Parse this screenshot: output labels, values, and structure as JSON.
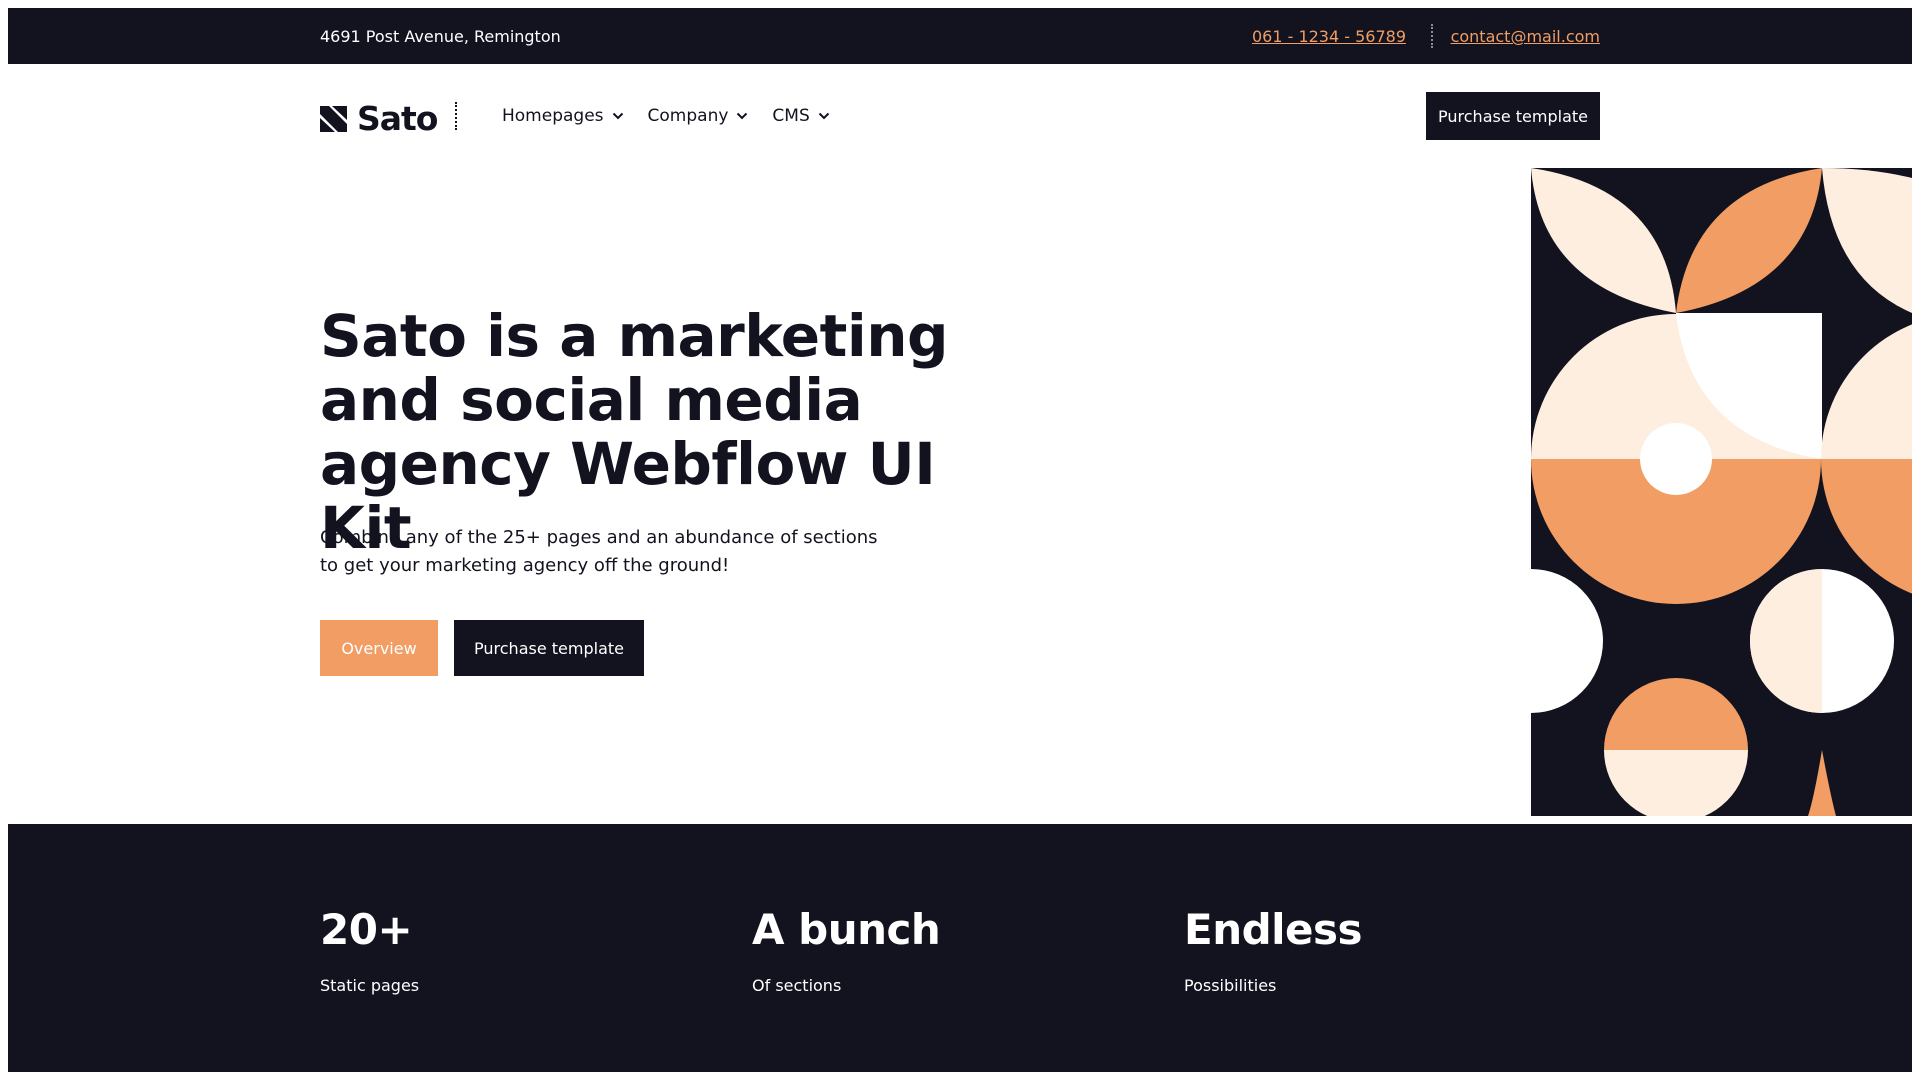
{
  "colors": {
    "dark": "#12131f",
    "accent": "#f19d64",
    "cream": "#fdeee0",
    "white": "#ffffff"
  },
  "topbar": {
    "address": "4691  Post Avenue, Remington",
    "phone": "061 - 1234 - 56789",
    "email": "contact@mail.com"
  },
  "nav": {
    "logo_text": "Sato",
    "logo_icon": "sato-logo-icon",
    "menu": [
      {
        "label": "Homepages",
        "icon": "chevron-down-icon"
      },
      {
        "label": "Company",
        "icon": "chevron-down-icon"
      },
      {
        "label": "CMS",
        "icon": "chevron-down-icon"
      }
    ],
    "cta_label": "Purchase template"
  },
  "hero": {
    "title": "Sato is a marketing and social media agency Webflow UI Kit",
    "subtitle_line1": "Combine any of the 25+ pages and an abundance of sections",
    "subtitle_line2": "to get your marketing agency off the ground!",
    "overview_label": "Overview",
    "purchase_label": "Purchase template"
  },
  "stats": [
    {
      "value": "20+",
      "label": "Static pages"
    },
    {
      "value": "A bunch",
      "label": "Of sections"
    },
    {
      "value": "Endless",
      "label": "Possibilities"
    }
  ]
}
